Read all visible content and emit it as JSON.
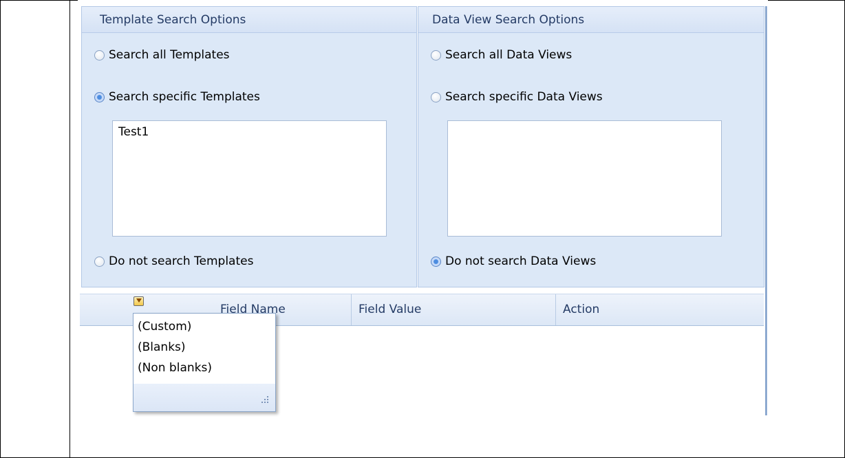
{
  "template_panel": {
    "header": "Template Search Options",
    "options": [
      {
        "label": "Search all Templates",
        "checked": false
      },
      {
        "label": "Search specific Templates",
        "checked": true
      },
      {
        "label": "Do not search Templates",
        "checked": false
      }
    ],
    "list_items": [
      "Test1"
    ]
  },
  "dataview_panel": {
    "header": "Data View Search Options",
    "options": [
      {
        "label": "Search all Data Views",
        "checked": false
      },
      {
        "label": "Search specific Data Views",
        "checked": false
      },
      {
        "label": "Do not search Data Views",
        "checked": true
      }
    ],
    "list_items": []
  },
  "grid": {
    "columns": [
      "Field Name",
      "Field Value",
      "Action"
    ]
  },
  "filter_dropdown": {
    "items": [
      "(Custom)",
      "(Blanks)",
      "(Non blanks)"
    ]
  },
  "colors": {
    "panel_bg": "#dce8f7",
    "header_text": "#243b65",
    "radio_checked": "#4d8de0"
  }
}
